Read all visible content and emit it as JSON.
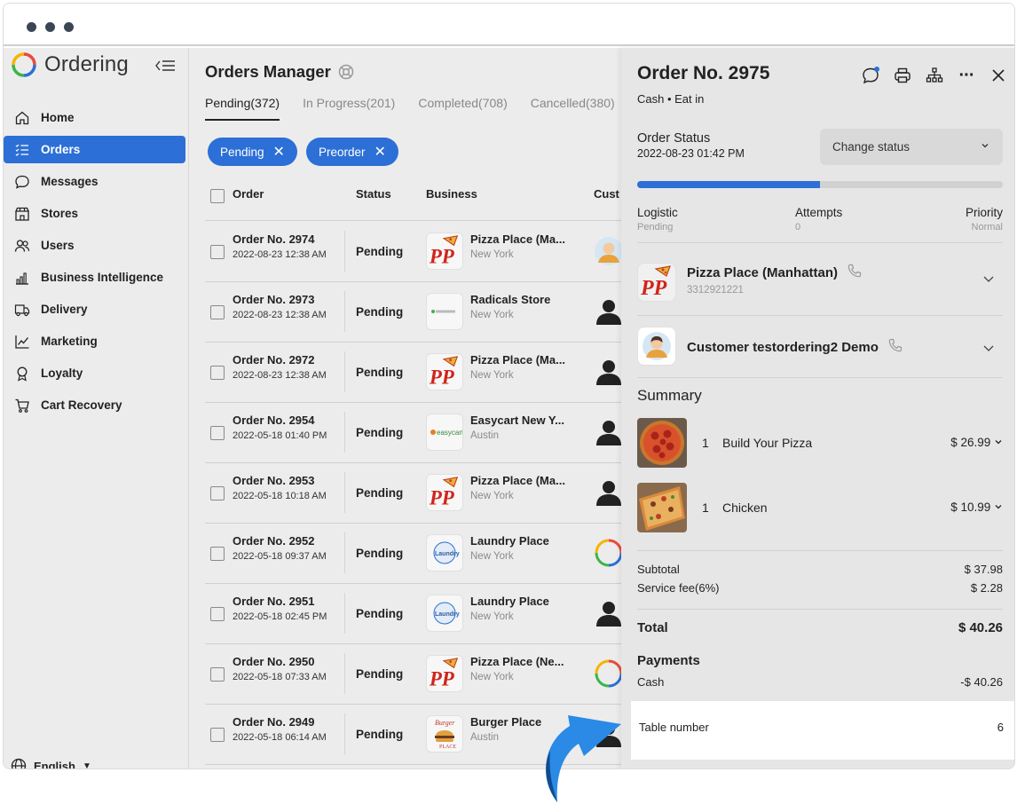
{
  "sidebar": {
    "brand": "Ordering",
    "items": [
      {
        "label": "Home",
        "icon": "home-icon"
      },
      {
        "label": "Orders",
        "icon": "list-icon",
        "active": true
      },
      {
        "label": "Messages",
        "icon": "chat-icon"
      },
      {
        "label": "Stores",
        "icon": "store-icon"
      },
      {
        "label": "Users",
        "icon": "users-icon"
      },
      {
        "label": "Business Intelligence",
        "icon": "bar-chart-icon"
      },
      {
        "label": "Delivery",
        "icon": "truck-icon"
      },
      {
        "label": "Marketing",
        "icon": "line-chart-icon"
      },
      {
        "label": "Loyalty",
        "icon": "award-icon"
      },
      {
        "label": "Cart Recovery",
        "icon": "cart-icon"
      }
    ],
    "language": "English"
  },
  "main": {
    "title": "Orders Manager",
    "tabs": [
      "Pending(372)",
      "In Progress(201)",
      "Completed(708)",
      "Cancelled(380)"
    ],
    "chips": [
      "Pending",
      "Preorder"
    ],
    "columns": [
      "Order",
      "Status",
      "Business",
      "Cust"
    ],
    "rows": [
      {
        "order": "Order No. 2974",
        "date": "2022-08-23 12:38 AM",
        "status": "Pending",
        "business": "Pizza Place (Ma...",
        "city": "New York",
        "logo": "pp"
      },
      {
        "order": "Order No. 2973",
        "date": "2022-08-23 12:38 AM",
        "status": "Pending",
        "business": "Radicals Store",
        "city": "New York",
        "logo": "radicals"
      },
      {
        "order": "Order No. 2972",
        "date": "2022-08-23 12:38 AM",
        "status": "Pending",
        "business": "Pizza Place (Ma...",
        "city": "New York",
        "logo": "pp"
      },
      {
        "order": "Order No. 2954",
        "date": "2022-05-18 01:40 PM",
        "status": "Pending",
        "business": "Easycart New Y...",
        "city": "Austin",
        "logo": "easycart"
      },
      {
        "order": "Order No. 2953",
        "date": "2022-05-18 10:18 AM",
        "status": "Pending",
        "business": "Pizza Place (Ma...",
        "city": "New York",
        "logo": "pp"
      },
      {
        "order": "Order No. 2952",
        "date": "2022-05-18 09:37 AM",
        "status": "Pending",
        "business": "Laundry Place",
        "city": "New York",
        "logo": "laundry"
      },
      {
        "order": "Order No. 2951",
        "date": "2022-05-18 02:45 PM",
        "status": "Pending",
        "business": "Laundry Place",
        "city": "New York",
        "logo": "laundry"
      },
      {
        "order": "Order No. 2950",
        "date": "2022-05-18 07:33 AM",
        "status": "Pending",
        "business": "Pizza Place (Ne...",
        "city": "New York",
        "logo": "pp"
      },
      {
        "order": "Order No. 2949",
        "date": "2022-05-18 06:14 AM",
        "status": "Pending",
        "business": "Burger Place",
        "city": "Austin",
        "logo": "burger"
      }
    ]
  },
  "panel": {
    "title": "Order No. 2975",
    "subtitle": "Cash • Eat in",
    "order_status_label": "Order Status",
    "order_status_date": "2022-08-23 01:42 PM",
    "change_status": "Change status",
    "progress": 0.5,
    "logistic_label": "Logistic",
    "logistic_value": "Pending",
    "attempts_label": "Attempts",
    "attempts_value": "0",
    "priority_label": "Priority",
    "priority_value": "Normal",
    "business_name": "Pizza Place (Manhattan)",
    "business_phone": "3312921221",
    "customer_name": "Customer testordering2 Demo",
    "summary_label": "Summary",
    "products": [
      {
        "qty": "1",
        "name": "Build Your Pizza",
        "price": "$ 26.99"
      },
      {
        "qty": "1",
        "name": "Chicken",
        "price": "$ 10.99"
      }
    ],
    "subtotal_label": "Subtotal",
    "subtotal_value": "$ 37.98",
    "service_label": "Service fee(6%)",
    "service_value": "$ 2.28",
    "total_label": "Total",
    "total_value": "$ 40.26",
    "payments_label": "Payments",
    "payment_method": "Cash",
    "payment_value": "-$ 40.26",
    "table_label": "Table number",
    "table_value": "6"
  },
  "colors": {
    "accent": "#2c6fd6",
    "arrow": "#2a8ae6"
  }
}
